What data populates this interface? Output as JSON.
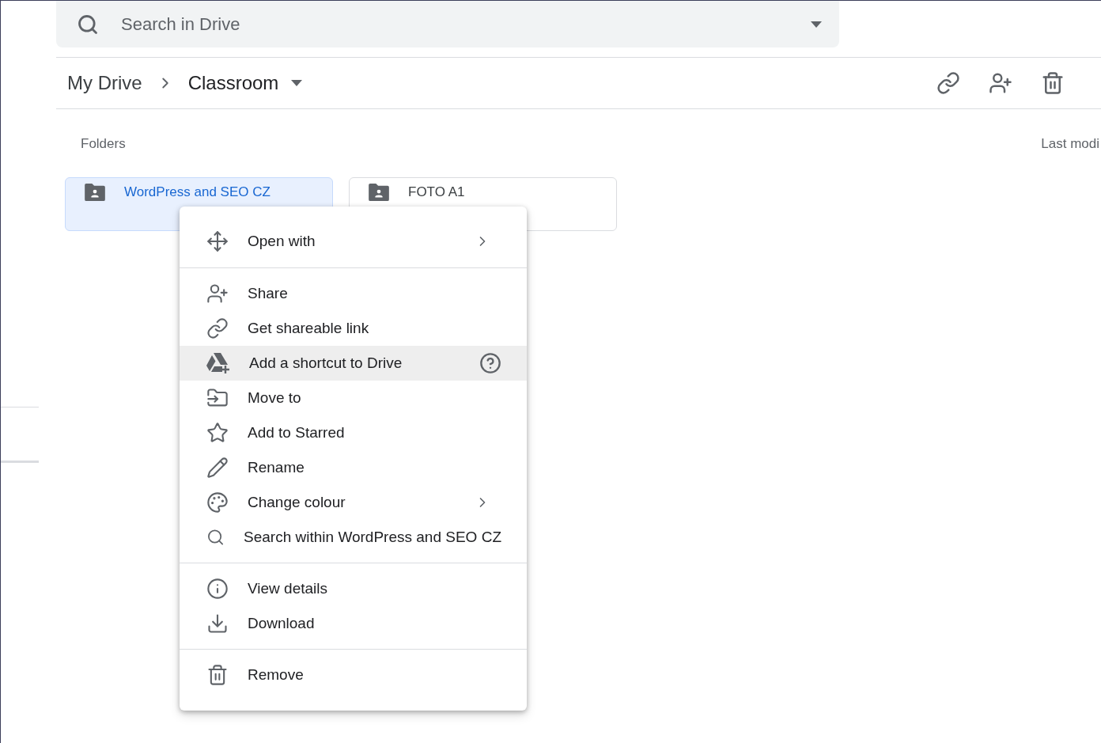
{
  "search": {
    "placeholder": "Search in Drive"
  },
  "breadcrumb": [
    {
      "label": "My Drive",
      "current": false
    },
    {
      "label": "Classroom",
      "current": true
    }
  ],
  "folders_heading": "Folders",
  "sort_label": "Last modi",
  "folders": [
    {
      "name": "WordPress and SEO CZ",
      "selected": true
    },
    {
      "name": "FOTO A1",
      "selected": false
    }
  ],
  "context_menu": {
    "groups": [
      [
        {
          "label": "Open with",
          "kind": "submenu",
          "highlighted": false
        }
      ],
      [
        {
          "label": "Share",
          "kind": "plain",
          "highlighted": false
        },
        {
          "label": "Get shareable link",
          "kind": "plain",
          "highlighted": false
        },
        {
          "label": "Add a shortcut to Drive",
          "kind": "help",
          "highlighted": true
        },
        {
          "label": "Move to",
          "kind": "plain",
          "highlighted": false
        },
        {
          "label": "Add to Starred",
          "kind": "plain",
          "highlighted": false
        },
        {
          "label": "Rename",
          "kind": "plain",
          "highlighted": false
        },
        {
          "label": "Change colour",
          "kind": "submenu",
          "highlighted": false
        },
        {
          "label": "Search within WordPress and SEO CZ",
          "kind": "plain",
          "highlighted": false
        }
      ],
      [
        {
          "label": "View details",
          "kind": "plain",
          "highlighted": false
        },
        {
          "label": "Download",
          "kind": "plain",
          "highlighted": false
        }
      ],
      [
        {
          "label": "Remove",
          "kind": "plain",
          "highlighted": false
        }
      ]
    ]
  }
}
